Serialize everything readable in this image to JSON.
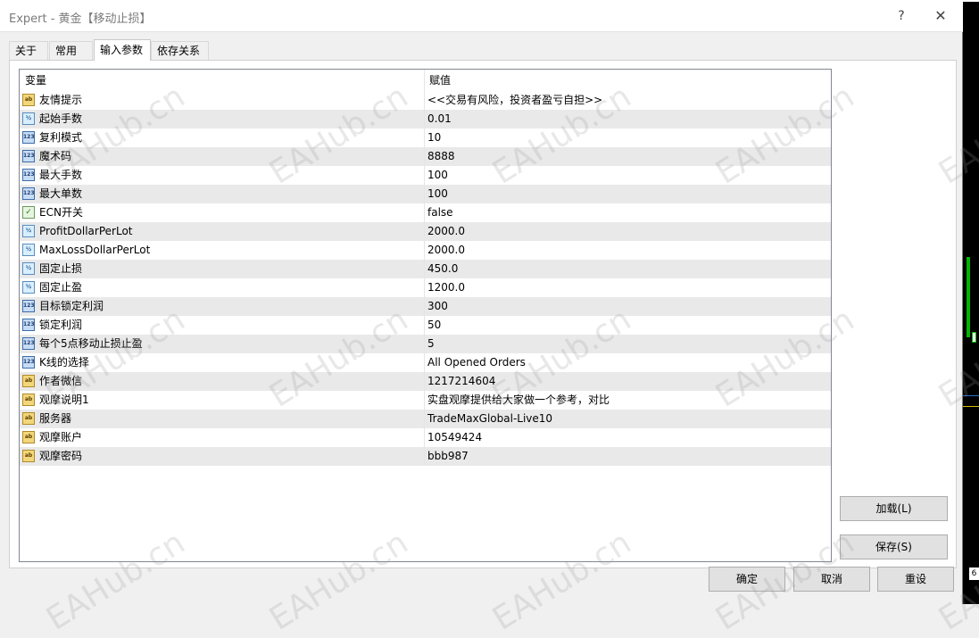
{
  "window": {
    "title": "Expert - 黄金【移动止损】",
    "help_label": "?",
    "close_label": "✕"
  },
  "tabs": [
    {
      "label": "关于",
      "active": false
    },
    {
      "label": "常用",
      "active": false
    },
    {
      "label": "输入参数",
      "active": true
    },
    {
      "label": "依存关系",
      "active": false
    }
  ],
  "grid": {
    "columns": [
      "变量",
      "赋值"
    ],
    "rows": [
      {
        "type": "string",
        "name": "友情提示",
        "value": "<<交易有风险，投资者盈亏自担>>"
      },
      {
        "type": "double",
        "name": "起始手数",
        "value": "0.01"
      },
      {
        "type": "int",
        "name": "复利模式",
        "value": "10"
      },
      {
        "type": "int",
        "name": "魔术码",
        "value": "8888"
      },
      {
        "type": "int",
        "name": "最大手数",
        "value": "100"
      },
      {
        "type": "int",
        "name": "最大单数",
        "value": "100"
      },
      {
        "type": "bool",
        "name": "ECN开关",
        "value": "false"
      },
      {
        "type": "double",
        "name": "ProfitDollarPerLot",
        "value": "2000.0"
      },
      {
        "type": "double",
        "name": "MaxLossDollarPerLot",
        "value": "2000.0"
      },
      {
        "type": "double",
        "name": "固定止损",
        "value": "450.0"
      },
      {
        "type": "double",
        "name": "固定止盈",
        "value": "1200.0"
      },
      {
        "type": "int",
        "name": "目标锁定利润",
        "value": "300"
      },
      {
        "type": "int",
        "name": "锁定利润",
        "value": "50"
      },
      {
        "type": "int",
        "name": "每个5点移动止损止盈",
        "value": "5"
      },
      {
        "type": "int",
        "name": "K线的选择",
        "value": "All Opened Orders"
      },
      {
        "type": "string",
        "name": "作者微信",
        "value": "1217214604"
      },
      {
        "type": "string",
        "name": "观摩说明1",
        "value": "实盘观摩提供给大家做一个参考，对比"
      },
      {
        "type": "string",
        "name": "服务器",
        "value": "TradeMaxGlobal-Live10"
      },
      {
        "type": "string",
        "name": "观摩账户",
        "value": "10549424"
      },
      {
        "type": "string",
        "name": "观摩密码",
        "value": "bbb987"
      }
    ]
  },
  "type_icons": {
    "string": {
      "icon": "string-param-icon",
      "glyph": "ab"
    },
    "double": {
      "icon": "double-param-icon",
      "glyph": "½"
    },
    "int": {
      "icon": "integer-param-icon",
      "glyph": "123"
    },
    "bool": {
      "icon": "bool-param-icon",
      "glyph": "✓"
    }
  },
  "buttons": {
    "load": "加载(L)",
    "save": "保存(S)",
    "ok": "确定",
    "cancel": "取消",
    "reset": "重设"
  },
  "watermark_text": "EAHub.cn",
  "chart_strip": {
    "label": "6",
    "colors": {
      "bull": "#00b400",
      "level_yellow": "#d4c000",
      "level_blue": "#2b6fd1"
    }
  }
}
